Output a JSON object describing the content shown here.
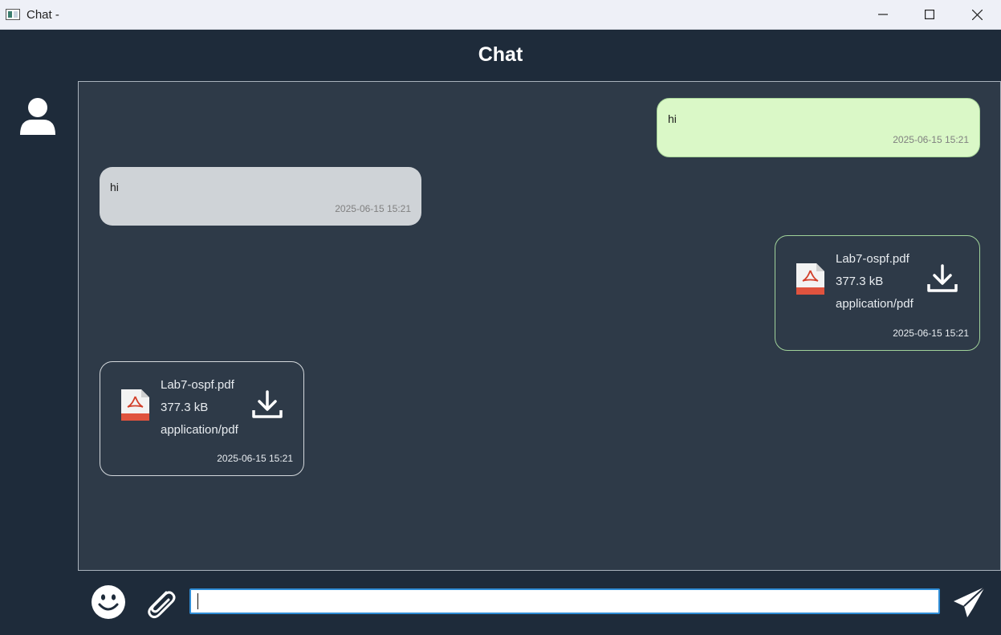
{
  "window": {
    "title": "Chat -"
  },
  "header": {
    "title": "Chat"
  },
  "messages": [
    {
      "kind": "text",
      "direction": "outgoing",
      "text": "hi",
      "time": "2025-06-15 15:21"
    },
    {
      "kind": "text",
      "direction": "incoming",
      "text": "hi",
      "time": "2025-06-15 15:21"
    },
    {
      "kind": "file",
      "direction": "outgoing",
      "name": "Lab7-ospf.pdf",
      "size": "377.3 kB",
      "type": "application/pdf",
      "time": "2025-06-15 15:21",
      "icon": "pdf-file-icon"
    },
    {
      "kind": "file",
      "direction": "incoming",
      "name": "Lab7-ospf.pdf",
      "size": "377.3 kB",
      "type": "application/pdf",
      "time": "2025-06-15 15:21",
      "icon": "pdf-file-icon"
    }
  ],
  "composer": {
    "value": "",
    "placeholder": ""
  },
  "icons": {
    "avatar": "user-icon",
    "emoji": "smiley-icon",
    "attach": "paperclip-icon",
    "send": "send-icon",
    "download": "download-icon"
  },
  "colors": {
    "background": "#1e2b3a",
    "chat_area": "#2e3a48",
    "outgoing_bubble": "#daf8c7",
    "incoming_bubble": "#cfd3d7",
    "input_focus_border": "#2f8dd6"
  }
}
